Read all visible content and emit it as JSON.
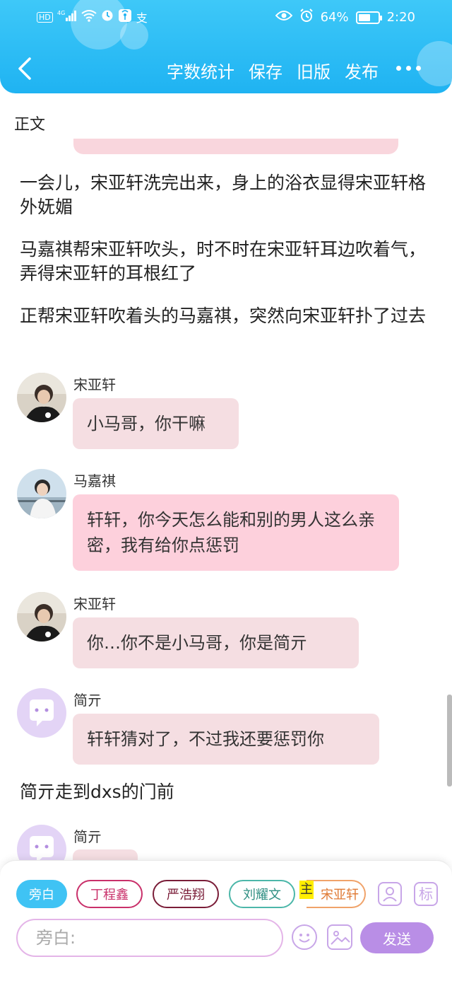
{
  "status_bar": {
    "network": "HD",
    "signal": "4G",
    "battery_pct": "64%",
    "battery_level": 0.64,
    "time": "2:20",
    "app_icon_text": "支"
  },
  "toolbar": {
    "word_count": "字数统计",
    "save": "保存",
    "old_version": "旧版",
    "publish": "发布"
  },
  "section_label": "正文",
  "narration": [
    "一会儿，宋亚轩洗完出来，身上的浴衣显得宋亚轩格外妩媚",
    "马嘉祺帮宋亚轩吹头，时不时在宋亚轩耳边吹着气，弄得宋亚轩的耳根红了",
    "正帮宋亚轩吹着头的马嘉祺，突然向宋亚轩扑了过去",
    "简亓走到dxs的门前"
  ],
  "messages": [
    {
      "sender": "宋亚轩",
      "text": "小马哥，你干嘛"
    },
    {
      "sender": "马嘉祺",
      "text": "轩轩，你今天怎么能和别的男人这么亲密，我有给你点惩罚"
    },
    {
      "sender": "宋亚轩",
      "text": "你…你不是小马哥，你是简亓"
    },
    {
      "sender": "简亓",
      "text": "轩轩猜对了，不过我还要惩罚你"
    },
    {
      "sender": "简亓",
      "text": ""
    }
  ],
  "roles": {
    "narrator": "旁白",
    "items": [
      "丁程鑫",
      "严浩翔",
      "刘耀文",
      "宋亚轩"
    ],
    "main_marker": "主",
    "mark_btn": "标"
  },
  "composer": {
    "placeholder": "旁白:",
    "send": "发送"
  },
  "colors": {
    "header": "#1fb3f2",
    "accent": "#b98ee6",
    "bubble": "#f5dee2",
    "bubble_pink": "#fdd0dc"
  }
}
